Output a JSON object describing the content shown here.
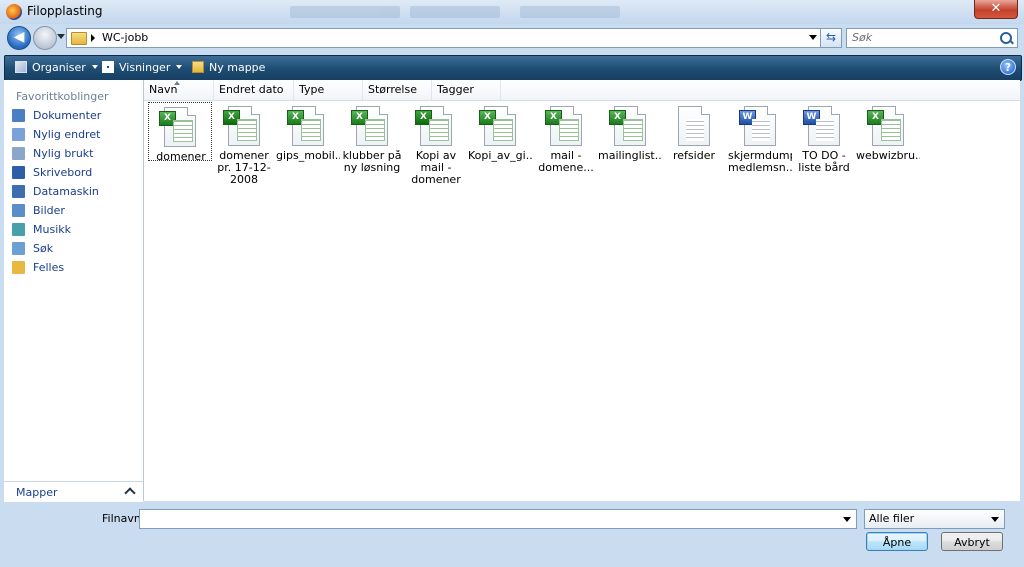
{
  "window": {
    "title": "Filopplasting",
    "close_glyph": "✕"
  },
  "nav": {
    "back_glyph": "◀",
    "address_path": "WC-jobb",
    "refresh_glyph": "⇆",
    "search_placeholder": "Søk"
  },
  "toolbar": {
    "organize_label": "Organiser",
    "views_label": "Visninger",
    "new_folder_label": "Ny mappe",
    "help_glyph": "?"
  },
  "sidebar": {
    "favorites_heading": "Favorittkoblinger",
    "items": [
      {
        "label": "Dokumenter",
        "icon": "documents-icon",
        "color": "#4a7fc4"
      },
      {
        "label": "Nylig endret",
        "icon": "recently-changed-icon",
        "color": "#7aa2d8"
      },
      {
        "label": "Nylig brukt",
        "icon": "recently-used-icon",
        "color": "#8aa6c8"
      },
      {
        "label": "Skrivebord",
        "icon": "desktop-icon",
        "color": "#2d5fa8"
      },
      {
        "label": "Datamaskin",
        "icon": "computer-icon",
        "color": "#3d6fb0"
      },
      {
        "label": "Bilder",
        "icon": "pictures-icon",
        "color": "#5c8dc9"
      },
      {
        "label": "Musikk",
        "icon": "music-icon",
        "color": "#4aa0a8"
      },
      {
        "label": "Søk",
        "icon": "search-folder-icon",
        "color": "#6c9fd2"
      },
      {
        "label": "Felles",
        "icon": "public-folder-icon",
        "color": "#e8b840"
      }
    ],
    "folders_label": "Mapper"
  },
  "columns": [
    "Navn",
    "Endret dato",
    "Type",
    "Størrelse",
    "Tagger"
  ],
  "files": [
    {
      "name": "domener",
      "type": "excel"
    },
    {
      "name": "domener pr. 17-12-2008",
      "type": "excel2"
    },
    {
      "name": "gips_mobil...",
      "type": "excel"
    },
    {
      "name": "klubber på ny løsning",
      "type": "excel"
    },
    {
      "name": "Kopi av mail - domener",
      "type": "excel2"
    },
    {
      "name": "Kopi_av_gi...",
      "type": "excel"
    },
    {
      "name": "mail - domene...",
      "type": "excel"
    },
    {
      "name": "mailinglist...",
      "type": "excel"
    },
    {
      "name": "refsider",
      "type": "text"
    },
    {
      "name": "skjermdump medlemsn...",
      "type": "word"
    },
    {
      "name": "TO DO - liste bård",
      "type": "word"
    },
    {
      "name": "webwizbru...",
      "type": "excel"
    }
  ],
  "bottom": {
    "filename_label": "Filnavn:",
    "filename_value": "",
    "filter_value": "Alle filer",
    "open_label": "Åpne",
    "cancel_label": "Avbryt"
  }
}
